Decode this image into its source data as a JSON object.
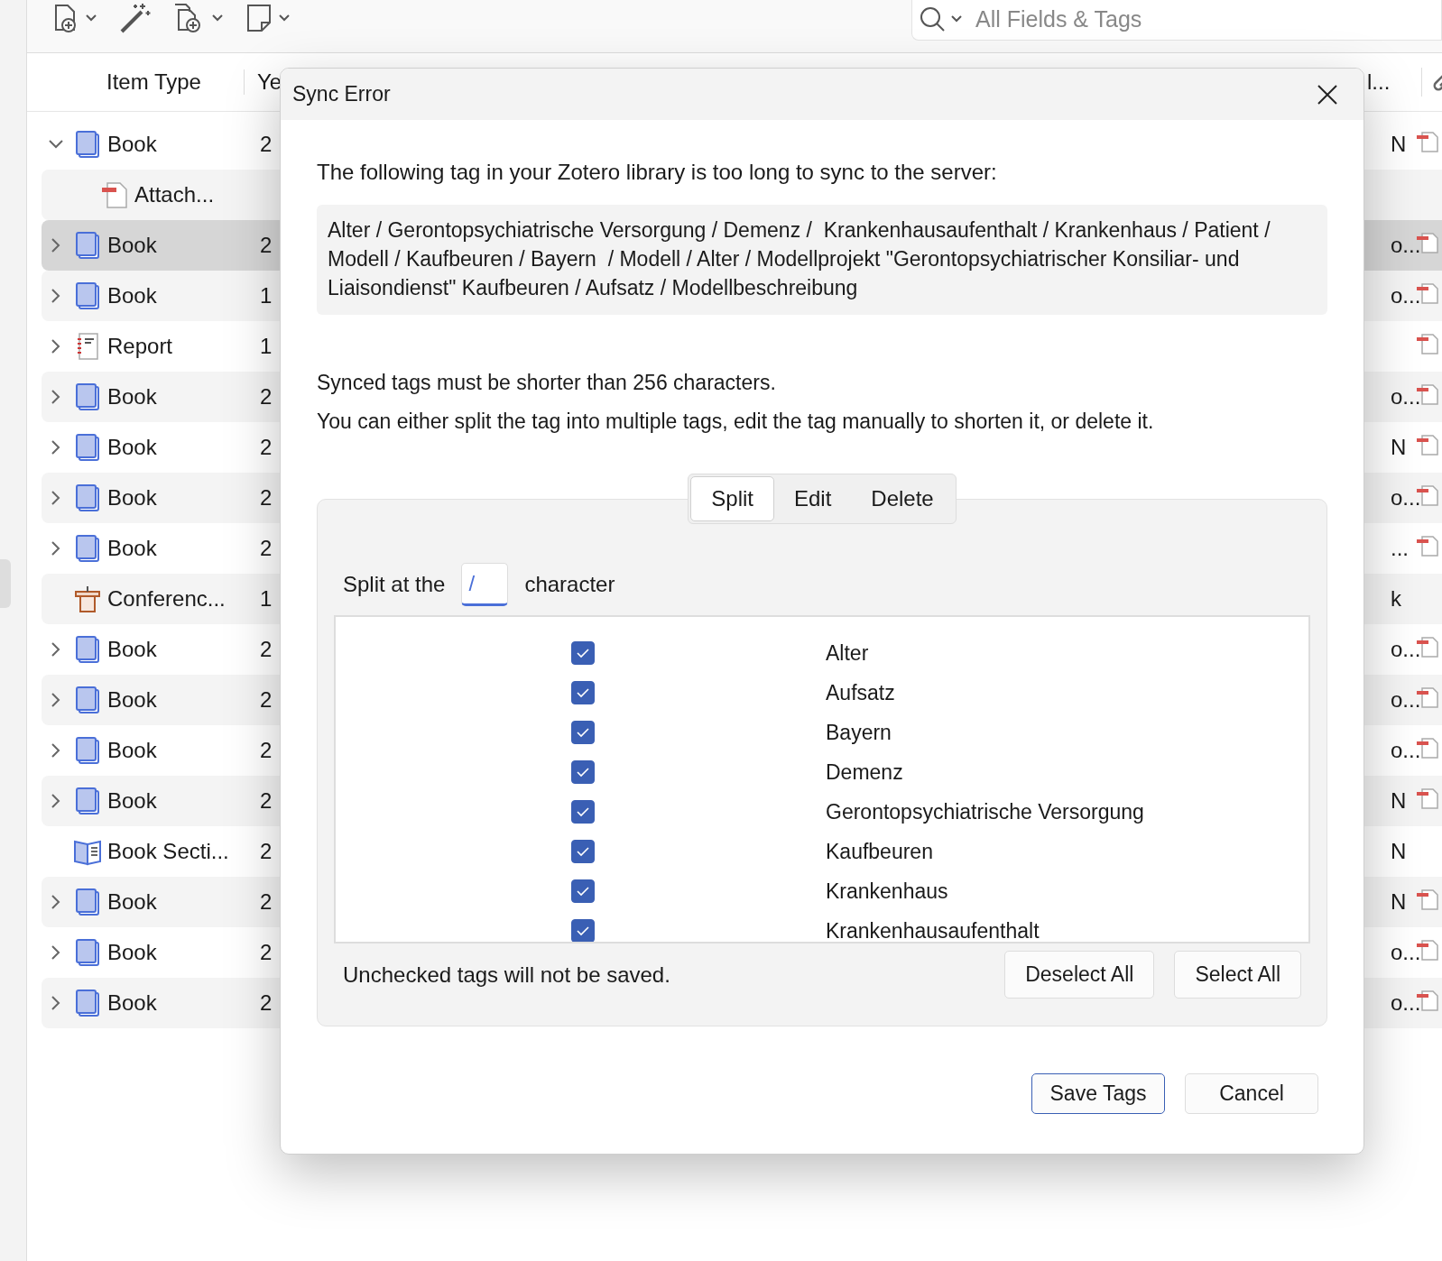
{
  "toolbar": {
    "search": {
      "placeholder": "All Fields & Tags"
    }
  },
  "columns": [
    {
      "label": "Item Type"
    },
    {
      "label": "Ye"
    },
    {
      "label": "l..."
    }
  ],
  "rows": [
    {
      "kind": "book",
      "label": "Book",
      "expanded": true,
      "year": "2",
      "extra": "N",
      "attachment": true,
      "selected": false,
      "children": [
        {
          "kind": "attachment",
          "label": "Attach...",
          "attachment": false,
          "selected": false
        }
      ]
    },
    {
      "kind": "book",
      "label": "Book",
      "expanded": false,
      "year": "2",
      "extra": "o...",
      "attachment": true,
      "selected": true
    },
    {
      "kind": "book",
      "label": "Book",
      "expanded": false,
      "year": "1",
      "extra": "o...",
      "attachment": true,
      "selected": false
    },
    {
      "kind": "report",
      "label": "Report",
      "expanded": false,
      "year": "1",
      "attachment": true,
      "selected": false
    },
    {
      "kind": "book",
      "label": "Book",
      "expanded": false,
      "year": "2",
      "extra": "o...",
      "attachment": true,
      "selected": false
    },
    {
      "kind": "book",
      "label": "Book",
      "expanded": false,
      "year": "2",
      "extra": "N",
      "attachment": true,
      "selected": false
    },
    {
      "kind": "book",
      "label": "Book",
      "expanded": false,
      "year": "2",
      "extra": "o...",
      "attachment": true,
      "selected": false
    },
    {
      "kind": "book",
      "label": "Book",
      "expanded": false,
      "year": "2",
      "extra": "...",
      "attachment": true,
      "selected": false
    },
    {
      "kind": "conference",
      "label": "Conferenc...",
      "year": "1",
      "extra": "k",
      "attachment": false,
      "selected": false
    },
    {
      "kind": "book",
      "label": "Book",
      "expanded": false,
      "year": "2",
      "extra": "o...",
      "attachment": true,
      "selected": false
    },
    {
      "kind": "book",
      "label": "Book",
      "expanded": false,
      "year": "2",
      "extra": "o...",
      "attachment": true,
      "selected": false
    },
    {
      "kind": "book",
      "label": "Book",
      "expanded": false,
      "year": "2",
      "extra": "o...",
      "attachment": true,
      "selected": false
    },
    {
      "kind": "book",
      "label": "Book",
      "expanded": false,
      "year": "2",
      "extra": "N",
      "attachment": true,
      "selected": false
    },
    {
      "kind": "section",
      "label": "Book Secti...",
      "year": "2",
      "extra": "N",
      "attachment": false,
      "selected": false
    },
    {
      "kind": "book",
      "label": "Book",
      "expanded": false,
      "year": "2",
      "extra": "N",
      "attachment": true,
      "selected": false
    },
    {
      "kind": "book",
      "label": "Book",
      "expanded": false,
      "year": "2",
      "extra": "o...",
      "attachment": true,
      "selected": false
    },
    {
      "kind": "book",
      "label": "Book",
      "expanded": false,
      "year": "2",
      "extra": "o...",
      "attachment": true,
      "selected": false
    }
  ],
  "dialog": {
    "title": "Sync Error",
    "message": "The following tag in your Zotero library is too long to sync to the server:",
    "tag": "Alter / Gerontopsychiatrische Versorgung / Demenz /  Krankenhausaufenthalt / Krankenhaus / Patient / Modell / Kaufbeuren / Bayern  / Modell / Alter / Modellprojekt \"Gerontopsychiatrischer Konsiliar- und Liaisondienst\" Kaufbeuren / Aufsatz / Modellbeschreibung",
    "notes": [
      "Synced tags must be shorter than 256 characters.",
      "You can either split the tag into multiple tags, edit the tag manually to shorten it, or delete it."
    ],
    "tabs": [
      {
        "label": "Split",
        "selected": true
      },
      {
        "label": "Edit",
        "selected": false
      },
      {
        "label": "Delete",
        "selected": false
      }
    ],
    "split": {
      "before": "Split at the",
      "value": "/",
      "after": "character"
    },
    "tags": [
      {
        "label": "Alter",
        "checked": true
      },
      {
        "label": "Aufsatz",
        "checked": true
      },
      {
        "label": "Bayern",
        "checked": true
      },
      {
        "label": "Demenz",
        "checked": true
      },
      {
        "label": "Gerontopsychiatrische Versorgung",
        "checked": true
      },
      {
        "label": "Kaufbeuren",
        "checked": true
      },
      {
        "label": "Krankenhaus",
        "checked": true
      },
      {
        "label": "Krankenhausaufenthalt",
        "checked": true
      }
    ],
    "hint": "Unchecked tags will not be saved.",
    "list_buttons": [
      "Deselect All",
      "Select All"
    ],
    "buttons": [
      {
        "label": "Save Tags",
        "default": true
      },
      {
        "label": "Cancel",
        "default": false
      }
    ]
  }
}
